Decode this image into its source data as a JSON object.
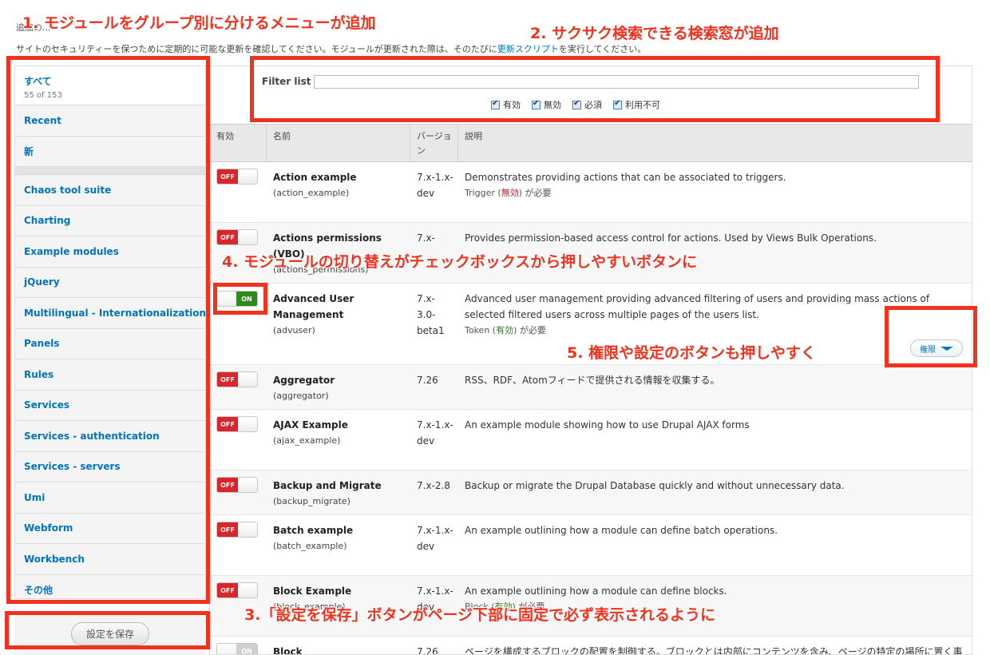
{
  "intro": {
    "partial": "追加の...",
    "line_prefix": "サイトのセキュリティーを保つために定期的に可能な更新を確認してください。モジュールが更新された際は、そのたびに",
    "line_link": "更新スクリプト",
    "line_suffix": "を実行してください。"
  },
  "sidebar": {
    "all_label": "すべて",
    "all_count": "55 of 153",
    "items": [
      "Recent",
      "新",
      "Chaos tool suite",
      "Charting",
      "Example modules",
      "jQuery",
      "Multilingual - Internationalization",
      "Panels",
      "Rules",
      "Services",
      "Services - authentication",
      "Services - servers",
      "Umi",
      "Webform",
      "Workbench",
      "その他"
    ]
  },
  "save_button": "設定を保存",
  "filter": {
    "label": "Filter list",
    "value": "",
    "checkboxes": [
      "有効",
      "無効",
      "必須",
      "利用不可"
    ]
  },
  "table": {
    "headers": {
      "enabled": "有効",
      "name": "名前",
      "version": "バージョン",
      "description": "説明"
    },
    "off_label": "OFF",
    "on_label": "ON",
    "perm_label": "権限",
    "modules": [
      {
        "name": "Action example",
        "machine": "(action_example)",
        "version": "7.x-1.x-dev",
        "desc": "Demonstrates providing actions that can be associated to triggers.",
        "req_prefix": "Trigger (",
        "req_status": "無効",
        "req_suffix": ") が必要",
        "on": false
      },
      {
        "name": "Actions permissions (VBO)",
        "machine": "(actions_permissions)",
        "version": "7.x-",
        "desc": "Provides permission-based access control for actions. Used by Views Bulk Operations.",
        "on": false
      },
      {
        "name": "Advanced User Management",
        "machine": "(advuser)",
        "version": "7.x-3.0-beta1",
        "desc": "Advanced user management providing advanced filtering of users and providing mass actions of selected filtered users across multiple pages of the users list.",
        "req_prefix": "Token (",
        "req_status": "有効",
        "req_suffix": ") が必要",
        "on": true
      },
      {
        "name": "Aggregator",
        "machine": "(aggregator)",
        "version": "7.26",
        "desc": "RSS、RDF、Atomフィードで提供される情報を収集する。",
        "on": false
      },
      {
        "name": "AJAX Example",
        "machine": "(ajax_example)",
        "version": "7.x-1.x-dev",
        "desc": "An example module showing how to use Drupal AJAX forms",
        "on": false
      },
      {
        "name": "Backup and Migrate",
        "machine": "(backup_migrate)",
        "version": "7.x-2.8",
        "desc": "Backup or migrate the Drupal Database quickly and without unnecessary data.",
        "on": false
      },
      {
        "name": "Batch example",
        "machine": "(batch_example)",
        "version": "7.x-1.x-dev",
        "desc": "An example outlining how a module can define batch operations.",
        "on": false
      },
      {
        "name": "Block Example",
        "machine": "(block_example)",
        "version": "7.x-1.x-dev",
        "desc": "An example outlining how a module can define blocks.",
        "req_prefix": "Block (",
        "req_status": "有効",
        "req_suffix": ") が必要",
        "on": false
      },
      {
        "name": "Block",
        "machine": "",
        "version": "7.26",
        "desc": "ページを構成するブロックの配置を制御する。ブロックとは内部にコンテンツを含み、ページの特定の場所に置く事",
        "on": true
      }
    ]
  },
  "annotations": [
    "1. モジュールをグループ別に分けるメニューが追加",
    "2. サクサク検索できる検索窓が追加",
    "3.「設定を保存」ボタンがページ下部に固定で必ず表示されるように",
    "4. モジュールの切り替えがチェックボックスから押しやすいボタンに",
    "5. 権限や設定のボタンも押しやすく"
  ],
  "colors": {
    "annotation": "#f0321e",
    "link": "#0074bd",
    "off": "#d9262c",
    "on": "#2e8a1e"
  }
}
